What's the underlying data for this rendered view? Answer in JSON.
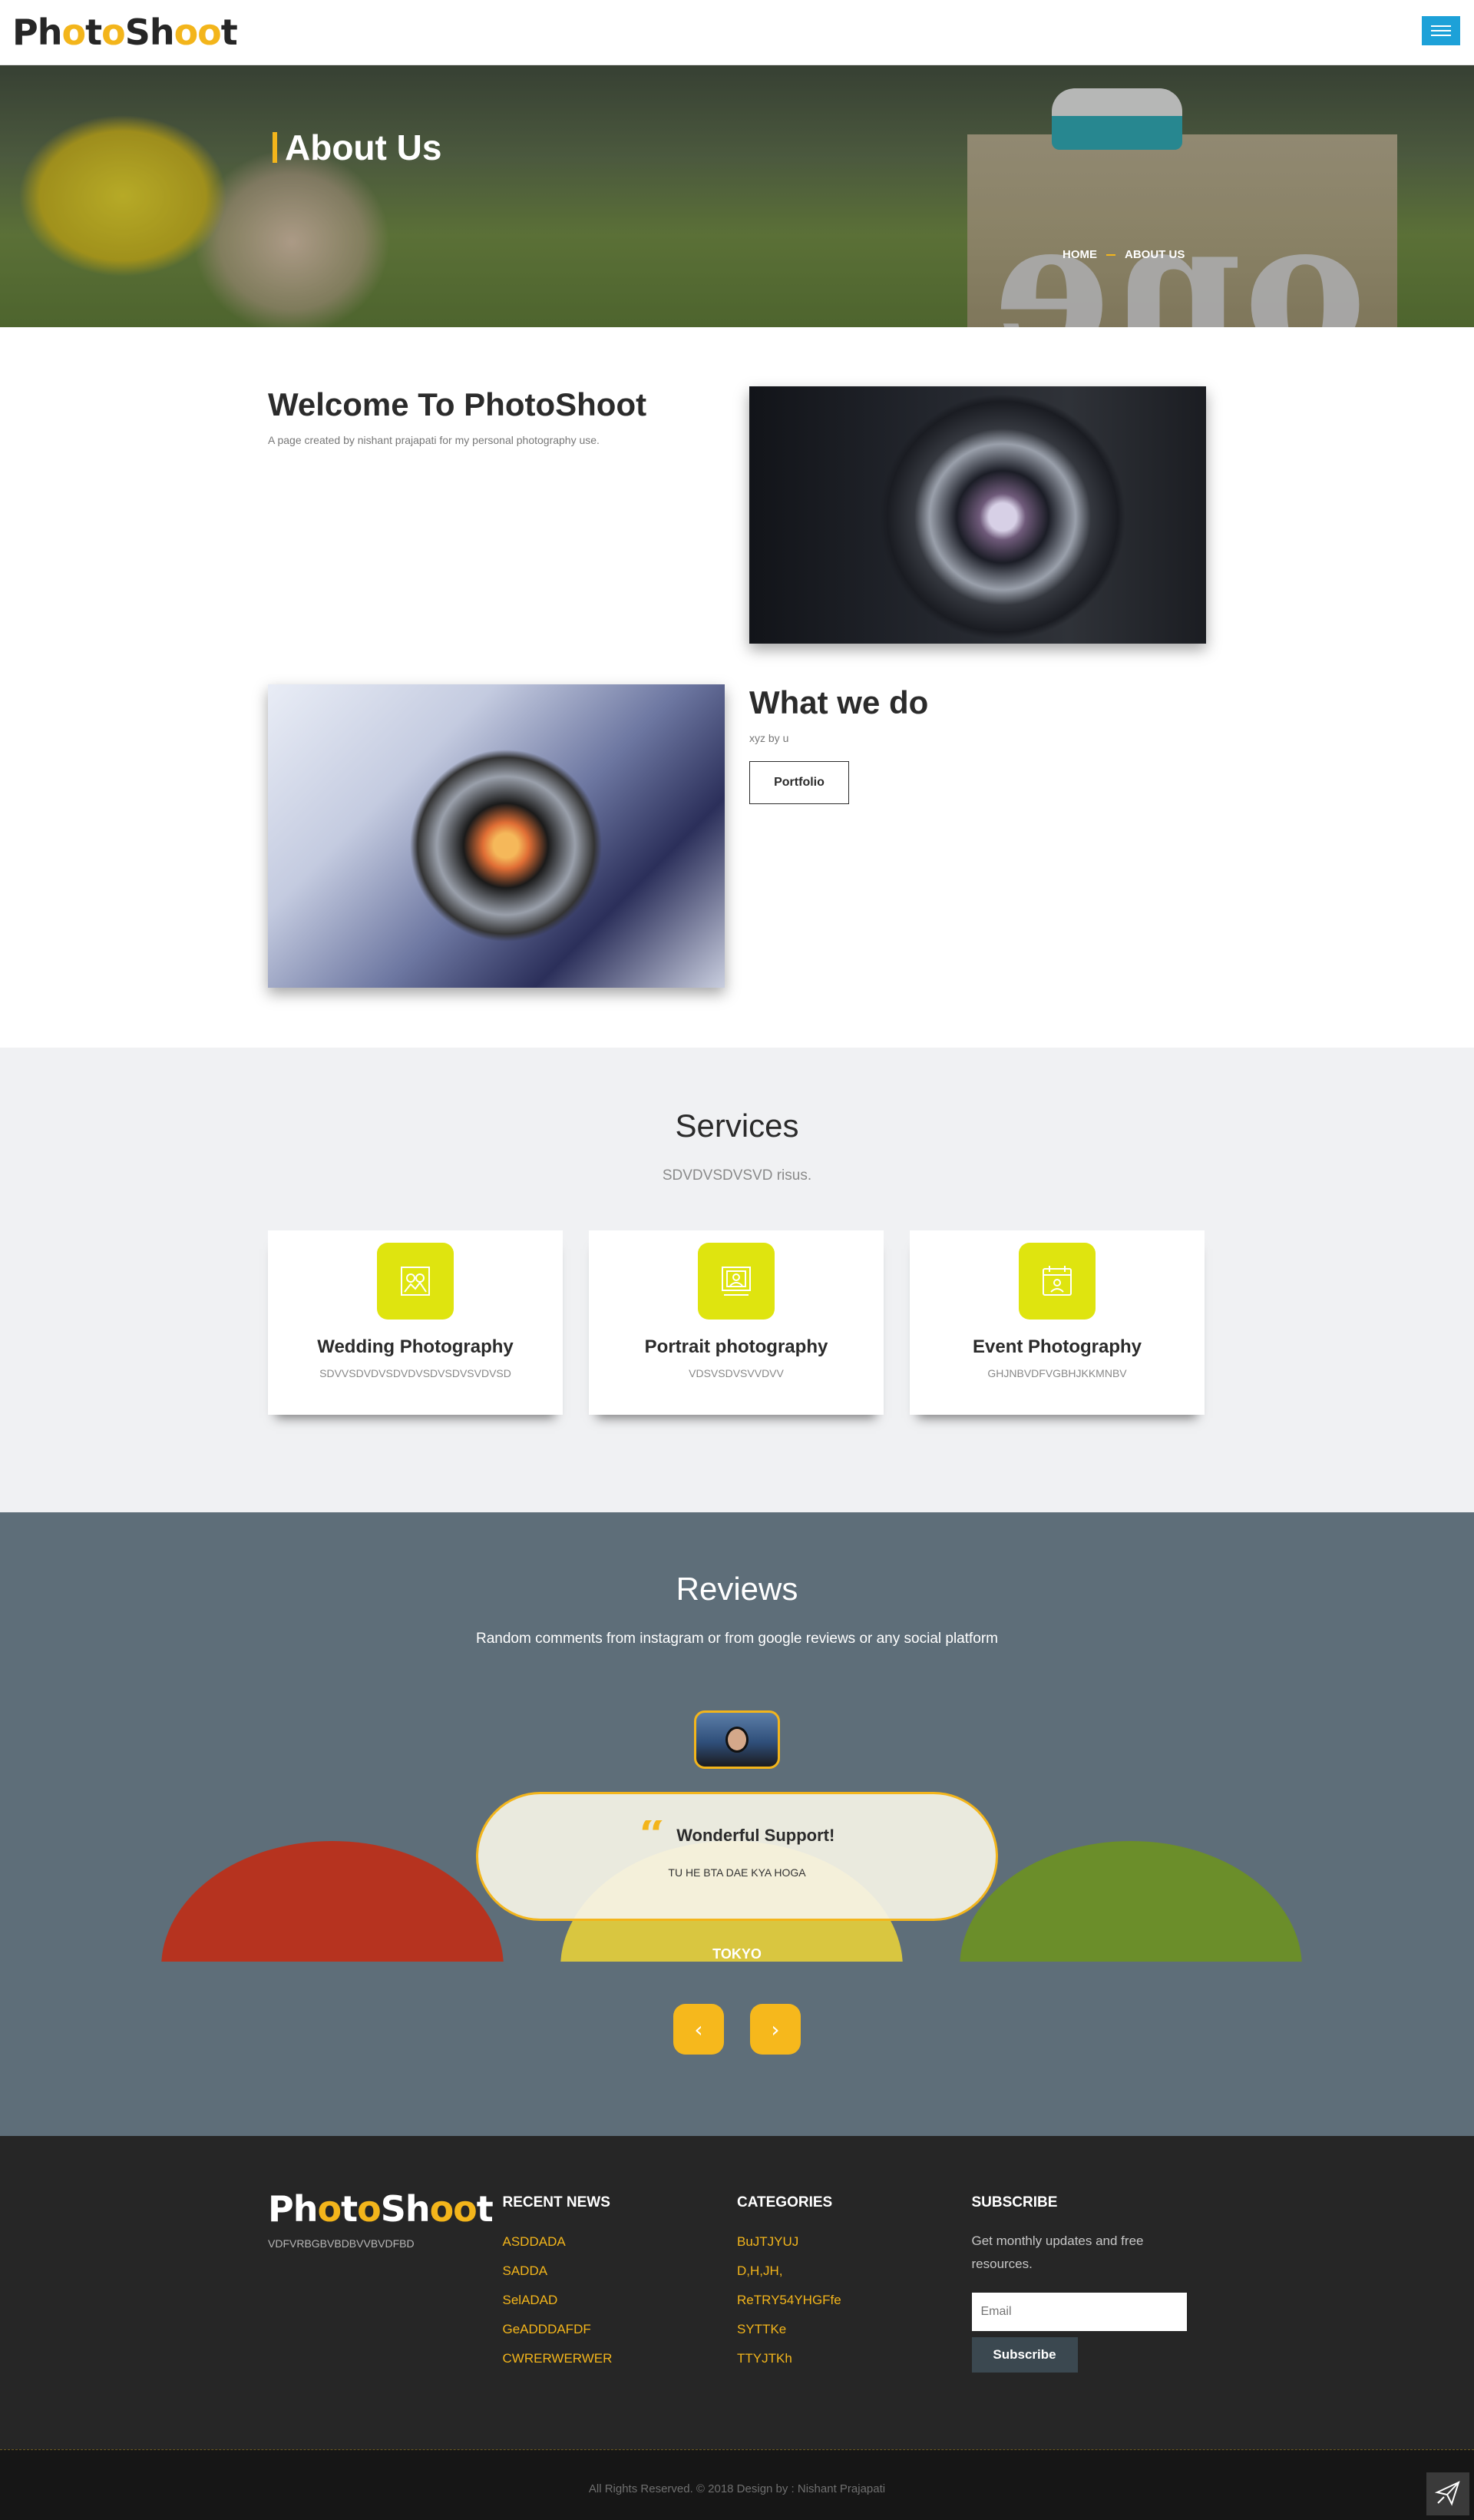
{
  "header": {
    "logo": {
      "part1": "Ph",
      "o1": "o",
      "part2": "t",
      "o2": "o",
      "part3": "Sh",
      "o3": "oo",
      "part4": "t"
    }
  },
  "hero": {
    "title": "About Us",
    "breadcrumb": {
      "home": "HOME",
      "current": "ABOUT US"
    }
  },
  "welcome": {
    "title": "Welcome To PhotoShoot",
    "text": "A page created by nishant prajapati for my personal photography use."
  },
  "what": {
    "title": "What we do",
    "text": "xyz by u",
    "button": "Portfolio"
  },
  "services": {
    "title": "Services",
    "subtitle": "SDVDVSDVSVD risus.",
    "items": [
      {
        "icon": "wedding-photos-icon",
        "title": "Wedding Photography",
        "text": "SDVVSDVDVSDVDVSDVSDVSVDVSD"
      },
      {
        "icon": "portrait-frame-icon",
        "title": "Portrait photography",
        "text": "VDSVSDVSVVDVV"
      },
      {
        "icon": "event-calendar-icon",
        "title": "Event Photography",
        "text": "GHJNBVDFVGBHJKKMNBV"
      }
    ]
  },
  "reviews": {
    "title": "Reviews",
    "subtitle": "Random comments from instagram or from google reviews or any social platform",
    "card": {
      "title": "Wonderful Support!",
      "text": "TU HE BTA DAE KYA HOGA",
      "name": "TOKYO"
    },
    "prev": "‹",
    "next": "›"
  },
  "footer": {
    "logo": {
      "part1": "Ph",
      "o1": "o",
      "part2": "t",
      "o2": "o",
      "part3": "Sh",
      "o3": "oo",
      "part4": "t"
    },
    "description": "VDFVRBGBVBDBVVBVDFBD",
    "recent_news": {
      "title": "RECENT NEWS",
      "items": [
        "ASDDADA",
        "SADDA",
        "SelADAD",
        "GeADDDAFDF",
        "CWRERWERWER"
      ]
    },
    "categories": {
      "title": "CATEGORIES",
      "items": [
        "BuJTJYUJ",
        "D,H,JH,",
        "ReTRY54YHGFfe",
        "SYTTKe",
        "TTYJTKh"
      ]
    },
    "subscribe": {
      "title": "SUBSCRIBE",
      "text": "Get monthly updates and free resources.",
      "placeholder": "Email",
      "button": "Subscribe"
    }
  },
  "copyright": "All Rights Reserved. © 2018 Design by : Nishant Prajapati",
  "colors": {
    "accent": "#f3b51b",
    "menu": "#1da1d8",
    "icon_bg": "#dfe40f",
    "reviews_bg": "#5e6e79",
    "footer_bg": "#262626"
  }
}
